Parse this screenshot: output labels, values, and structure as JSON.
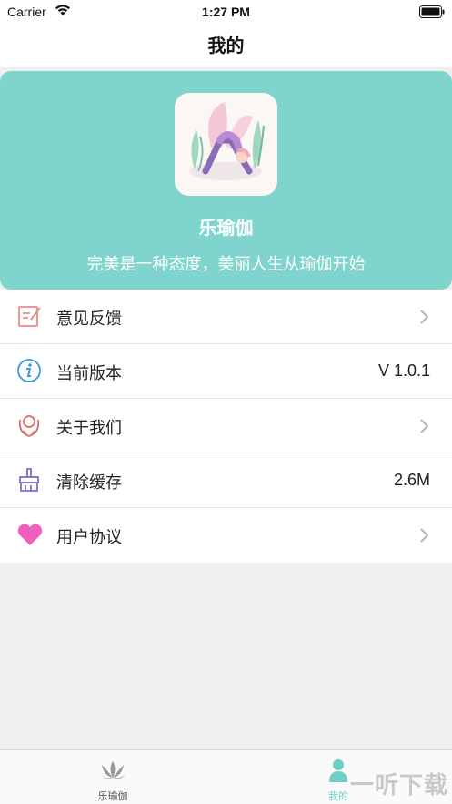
{
  "status_bar": {
    "carrier": "Carrier",
    "time": "1:27 PM"
  },
  "nav": {
    "title": "我的"
  },
  "hero": {
    "background_color": "#7fd5ce",
    "app_icon": "yoga-app-icon",
    "app_name": "乐瑜伽",
    "slogan": "完美是一种态度，美丽人生从瑜伽开始"
  },
  "menu": {
    "items": [
      {
        "label": "意见反馈",
        "icon": "feedback-icon",
        "value": "",
        "chevron": true
      },
      {
        "label": "当前版本",
        "icon": "info-icon",
        "value": "V 1.0.1",
        "chevron": false
      },
      {
        "label": "关于我们",
        "icon": "about-icon",
        "value": "",
        "chevron": true
      },
      {
        "label": "清除缓存",
        "icon": "broom-icon",
        "value": "2.6M",
        "chevron": false
      },
      {
        "label": "用户协议",
        "icon": "heart-icon",
        "value": "",
        "chevron": true
      }
    ]
  },
  "tab_bar": {
    "tabs": [
      {
        "label": "乐瑜伽",
        "icon": "lotus-icon",
        "selected": false
      },
      {
        "label": "我的",
        "icon": "person-icon",
        "selected": true
      }
    ],
    "accent_color": "#6fcfc6"
  },
  "watermark": {
    "text": "一听下载"
  }
}
